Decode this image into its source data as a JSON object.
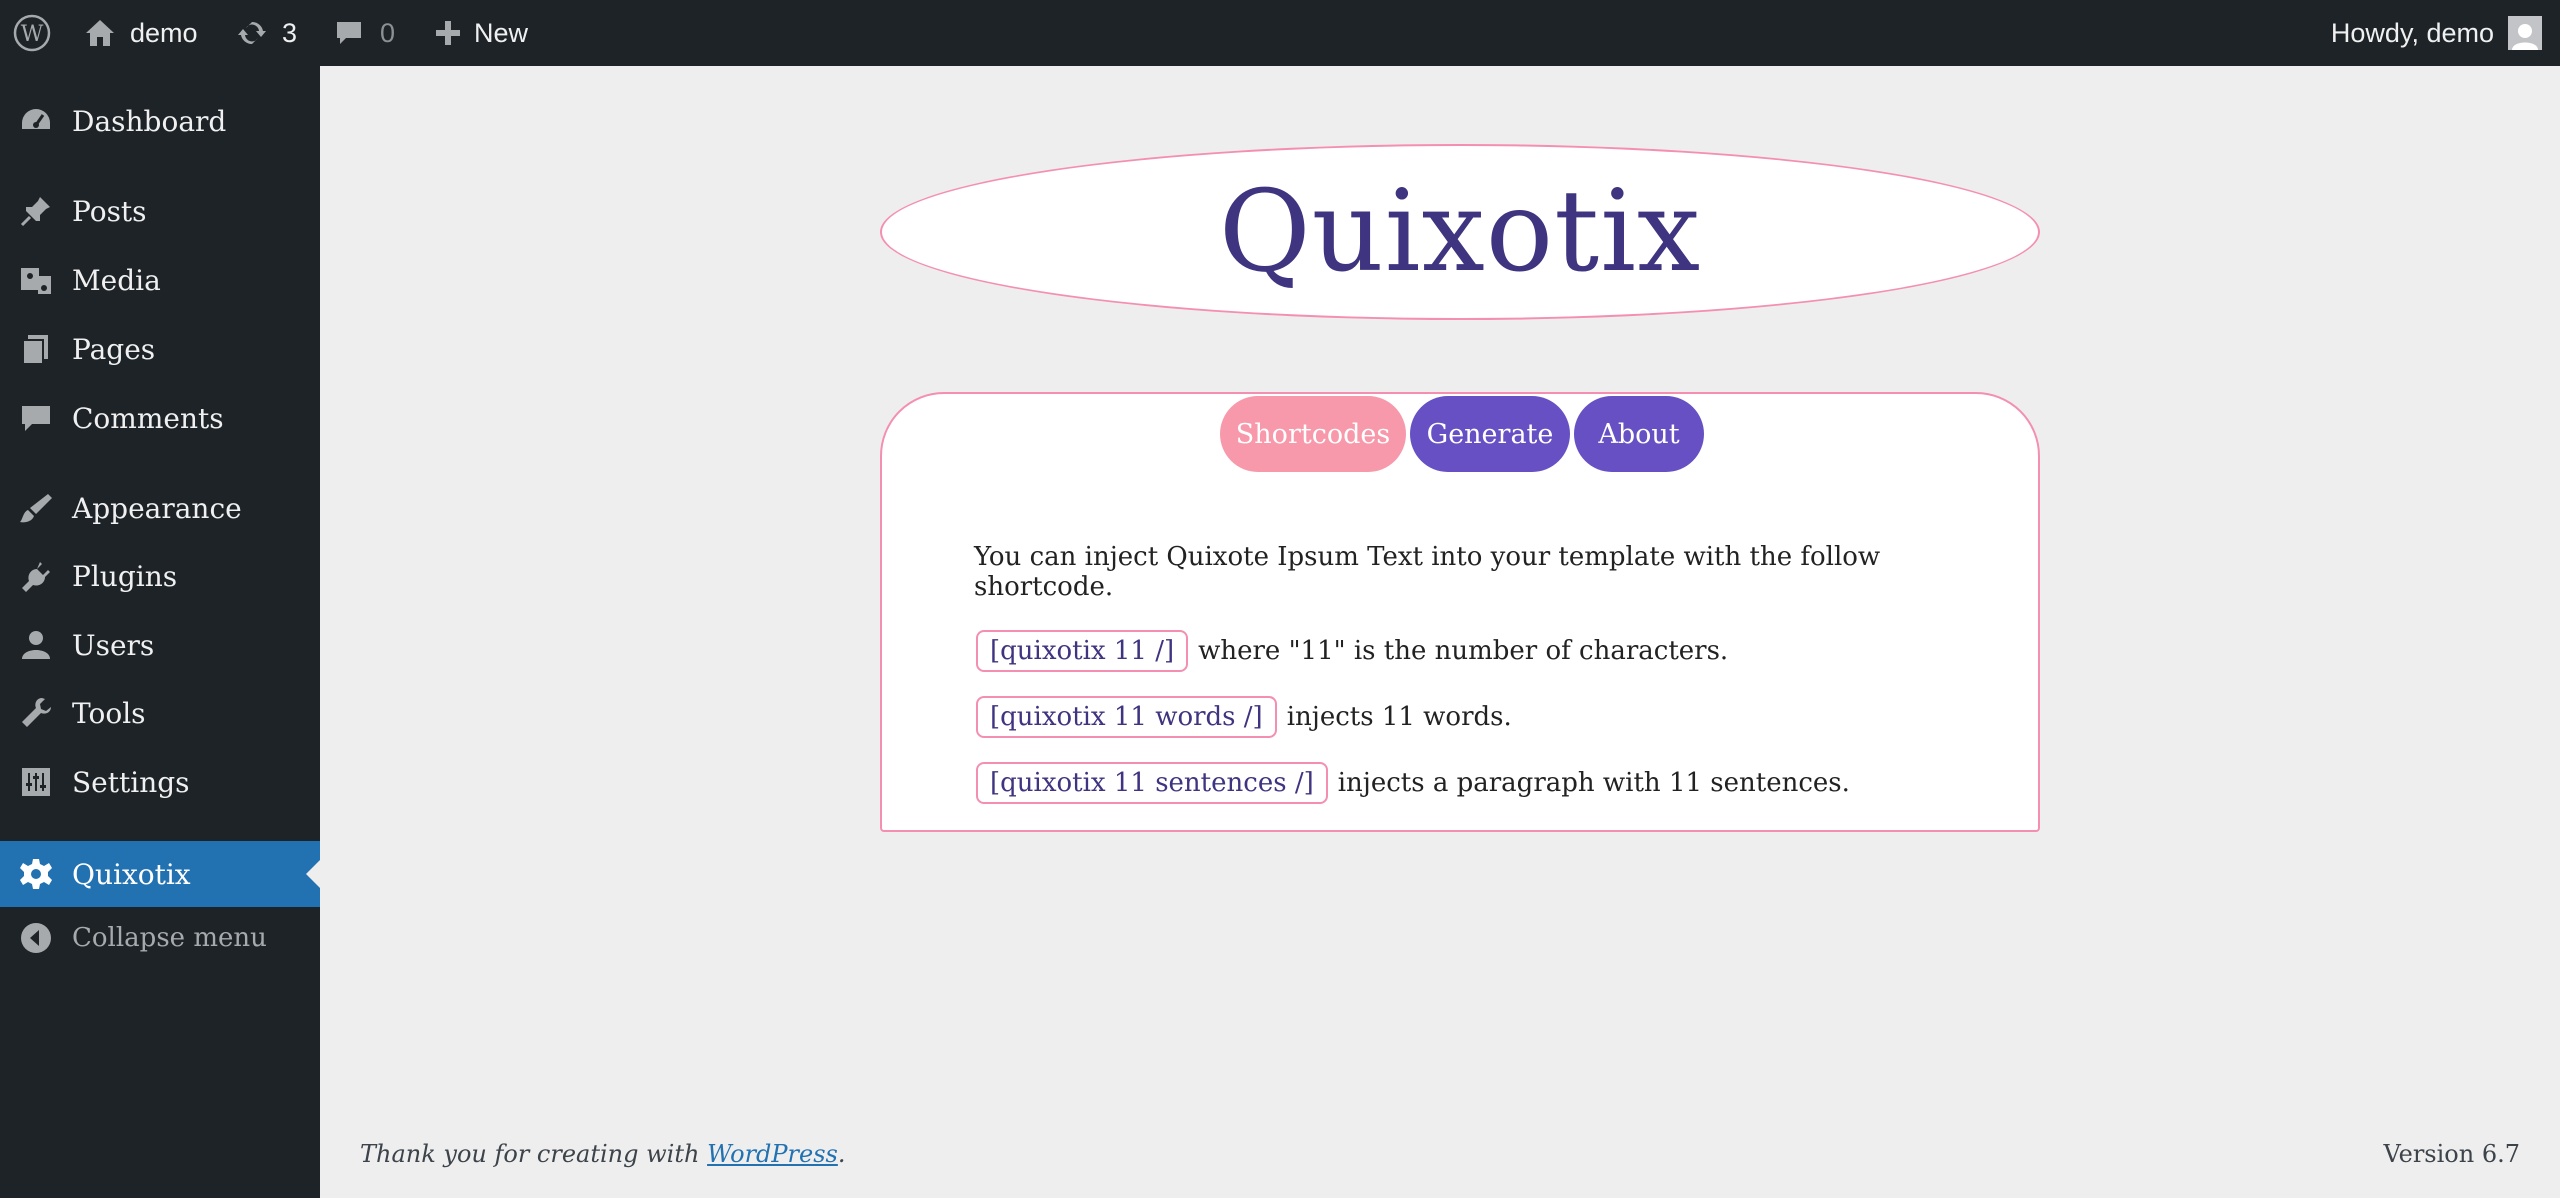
{
  "adminbar": {
    "site_name": "demo",
    "updates_count": "3",
    "comments_count": "0",
    "new_label": "New",
    "howdy": "Howdy, demo"
  },
  "sidebar": {
    "items": [
      {
        "label": "Dashboard",
        "icon": "dashboard-icon"
      },
      {
        "label": "Posts",
        "icon": "pin-icon"
      },
      {
        "label": "Media",
        "icon": "media-icon"
      },
      {
        "label": "Pages",
        "icon": "pages-icon"
      },
      {
        "label": "Comments",
        "icon": "comment-icon"
      },
      {
        "label": "Appearance",
        "icon": "brush-icon"
      },
      {
        "label": "Plugins",
        "icon": "plug-icon"
      },
      {
        "label": "Users",
        "icon": "user-icon"
      },
      {
        "label": "Tools",
        "icon": "wrench-icon"
      },
      {
        "label": "Settings",
        "icon": "settings-icon"
      },
      {
        "label": "Quixotix",
        "icon": "gear-icon",
        "active": true
      },
      {
        "label": "Collapse menu",
        "icon": "collapse-icon"
      }
    ]
  },
  "plugin": {
    "title": "Quixotix",
    "tabs": [
      "Shortcodes",
      "Generate",
      "About"
    ],
    "active_tab": "Shortcodes",
    "intro": "You can inject Quixote Ipsum Text into your template with the follow shortcode.",
    "shortcodes": [
      {
        "code": "[quixotix 11 /]",
        "desc": "where \"11\" is the number of characters."
      },
      {
        "code": "[quixotix 11 words /]",
        "desc": "injects 11 words."
      },
      {
        "code": "[quixotix 11 sentences /]",
        "desc": "injects a paragraph with 11 sentences."
      }
    ]
  },
  "footer": {
    "thanks_prefix": "Thank you for creating with ",
    "wordpress_link": "WordPress",
    "thanks_suffix": ".",
    "version": "Version 6.7"
  },
  "colors": {
    "adminbar_bg": "#1d2327",
    "active_menu": "#2271b1",
    "pink": "#f799aa",
    "purple": "#6750c4",
    "title": "#3f3480"
  }
}
